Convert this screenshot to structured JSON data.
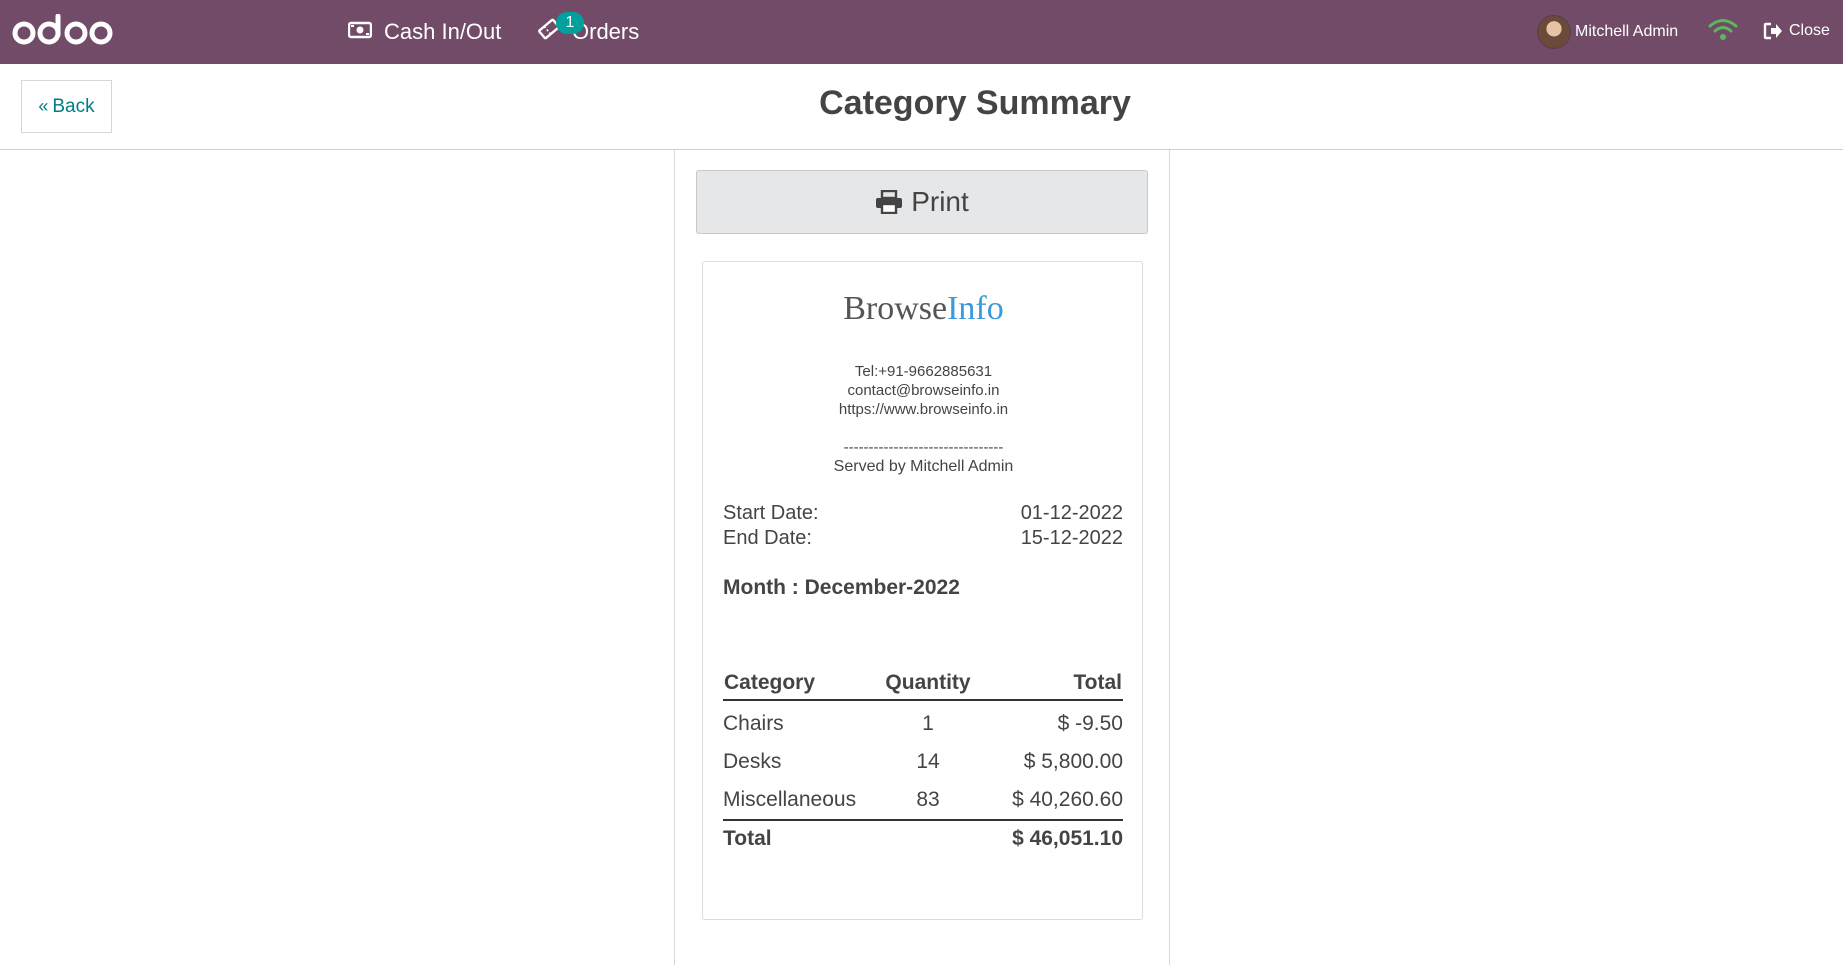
{
  "topbar": {
    "logo": "odoo",
    "nav": [
      {
        "label": "Cash In/Out",
        "icon": "money-icon"
      },
      {
        "label": "Orders",
        "icon": "ticket-icon",
        "badge": "1"
      }
    ],
    "user": "Mitchell Admin",
    "close_label": "Close",
    "wifi_color": "#5cb85c",
    "bar_color": "#714b67"
  },
  "header": {
    "back_label": "Back",
    "title": "Category Summary"
  },
  "print_label": "Print",
  "receipt": {
    "brand_part1": "Browse",
    "brand_part2": "Info",
    "tel": "Tel:+91-9662885631",
    "email": "contact@browseinfo.in",
    "website": "https://www.browseinfo.in",
    "separator": "--------------------------------",
    "served_by": "Served by Mitchell Admin",
    "start_date_label": "Start Date:",
    "start_date": "01-12-2022",
    "end_date_label": "End Date:",
    "end_date": "15-12-2022",
    "month": "Month : December-2022",
    "columns": [
      "Category",
      "Quantity",
      "Total"
    ],
    "rows": [
      {
        "category": "Chairs",
        "quantity": "1",
        "total": "$ -9.50"
      },
      {
        "category": "Desks",
        "quantity": "14",
        "total": "$ 5,800.00"
      },
      {
        "category": "Miscellaneous",
        "quantity": "83",
        "total": "$ 40,260.60"
      }
    ],
    "total_label": "Total",
    "grand_total": "$ 46,051.10"
  }
}
